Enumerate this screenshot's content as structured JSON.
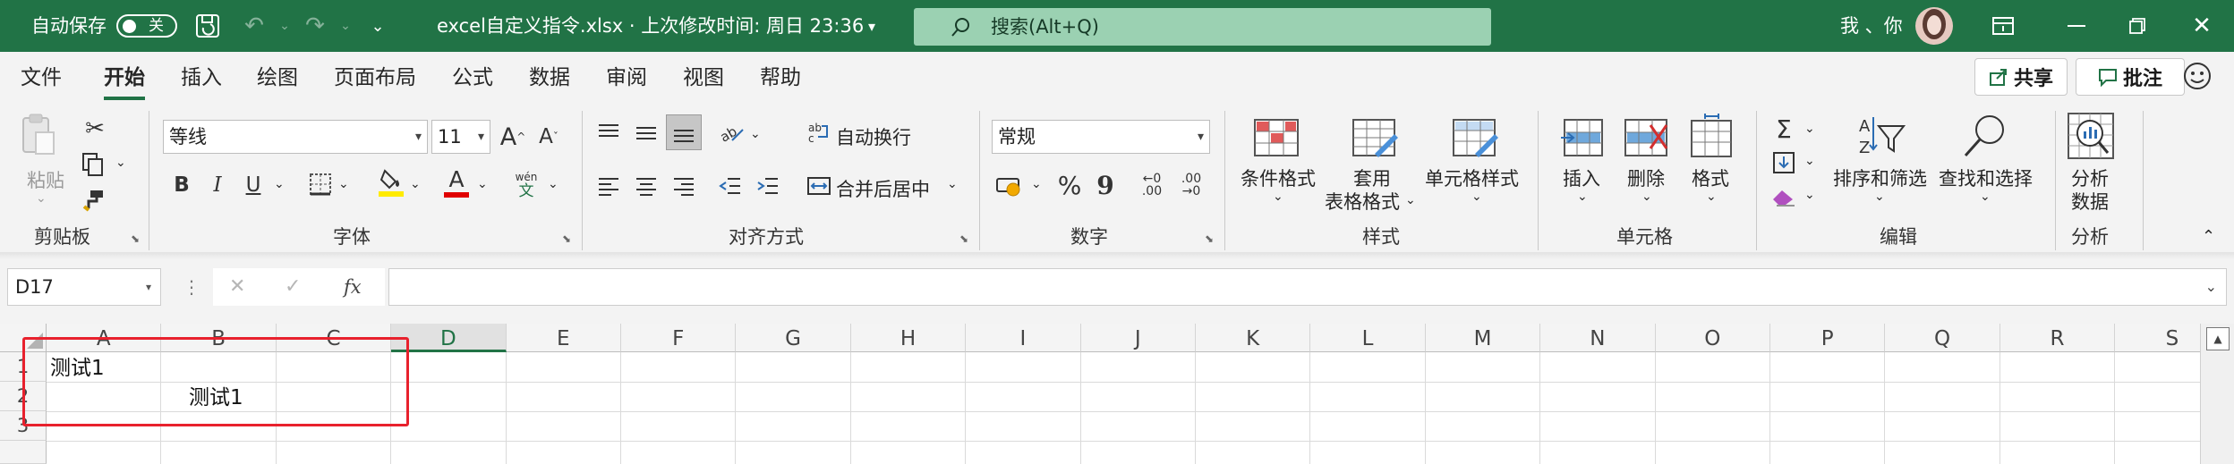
{
  "titlebar": {
    "autosave_label": "自动保存",
    "autosave_state": "关",
    "title": "excel自定义指令.xlsx · 上次修改时间: 周日 23:36",
    "search_placeholder": "搜索(Alt+Q)",
    "user": "我 、你"
  },
  "menu": {
    "tabs": [
      "文件",
      "开始",
      "插入",
      "绘图",
      "页面布局",
      "公式",
      "数据",
      "审阅",
      "视图",
      "帮助"
    ],
    "active": "开始",
    "share": "共享",
    "comment": "批注"
  },
  "ribbon": {
    "clipboard": {
      "paste": "粘贴",
      "group": "剪贴板"
    },
    "font": {
      "name": "等线",
      "size": "11",
      "grow": "A",
      "shrink": "A",
      "bold": "B",
      "italic": "I",
      "underline": "U",
      "font_color": "A",
      "phonetic_top": "wén",
      "phonetic": "文",
      "group": "字体"
    },
    "alignment": {
      "wrap": "自动换行",
      "merge": "合并后居中",
      "group": "对齐方式"
    },
    "number": {
      "format": "常规",
      "percent": "%",
      "comma": "9",
      "inc": "←0 .00",
      "dec": ".00 →0",
      "group": "数字"
    },
    "styles": {
      "conditional": "条件格式",
      "table_line1": "套用",
      "table_line2": "表格格式",
      "cell_styles": "单元格样式",
      "group": "样式"
    },
    "cells": {
      "insert": "插入",
      "delete": "删除",
      "format": "格式",
      "group": "单元格"
    },
    "editing": {
      "sort": "排序和筛选",
      "find": "查找和选择",
      "group": "编辑"
    },
    "analysis": {
      "analyze_line1": "分析",
      "analyze_line2": "数据",
      "group": "分析"
    }
  },
  "formula_bar": {
    "name_box": "D17",
    "cancel": "✕",
    "enter": "✓",
    "fx": "fx",
    "value": ""
  },
  "sheet": {
    "columns": [
      "A",
      "B",
      "C",
      "D",
      "E",
      "F",
      "G",
      "H",
      "I",
      "J",
      "K",
      "L",
      "M",
      "N",
      "O",
      "P",
      "Q",
      "R",
      "S"
    ],
    "selected_column": "D",
    "rows": [
      "1",
      "2",
      "3"
    ],
    "cells": {
      "A1": "测试1",
      "B2": "测试1"
    }
  },
  "colors": {
    "brand": "#217346",
    "highlight": "#e8212d"
  }
}
